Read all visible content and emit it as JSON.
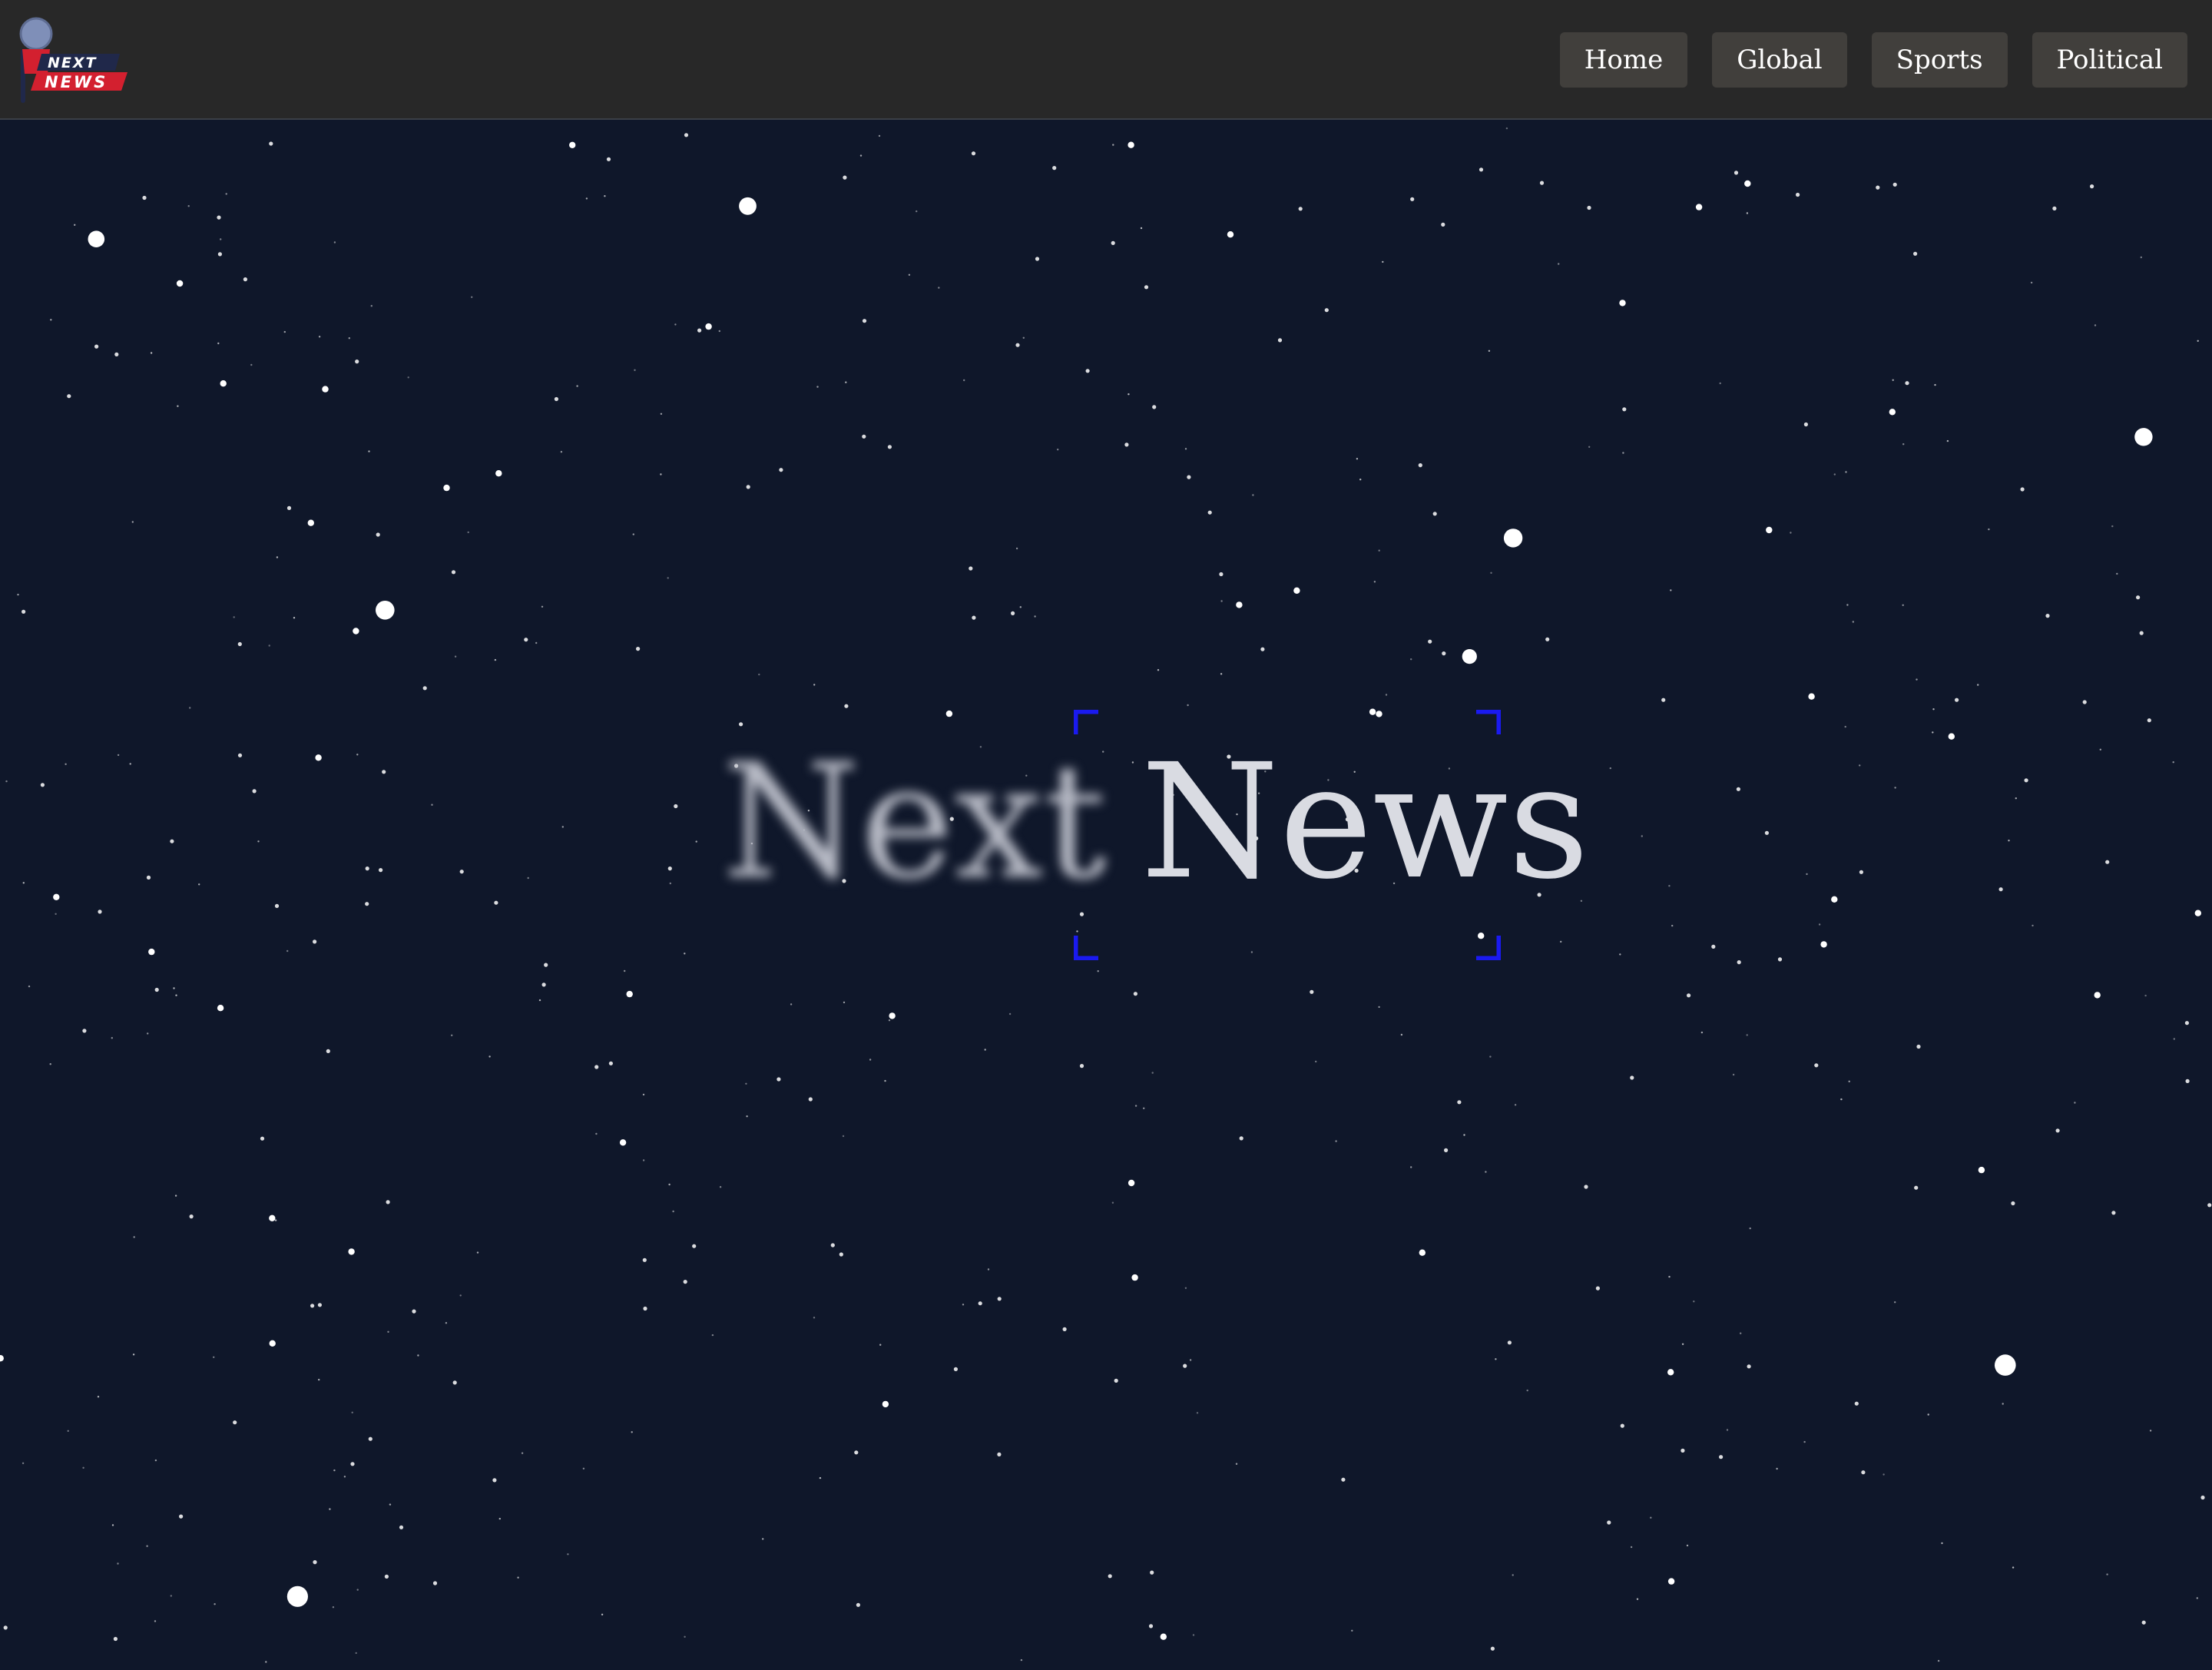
{
  "header": {
    "logo": {
      "top_line": "NEXT",
      "bottom_line": "NEWS",
      "icon": "microphone-icon",
      "colors": {
        "red": "#d3202f",
        "navy": "#20284a",
        "mic": "#7f8fb8"
      }
    },
    "nav": [
      {
        "label": "Home"
      },
      {
        "label": "Global"
      },
      {
        "label": "Sports"
      },
      {
        "label": "Political"
      }
    ]
  },
  "hero": {
    "word1": "Next",
    "word2": "News",
    "focus_color": "#1a1af0"
  },
  "colors": {
    "background": "#0f172a",
    "topbar": "#282828",
    "nav_button": "#413f3c",
    "star": "#ffffff"
  }
}
